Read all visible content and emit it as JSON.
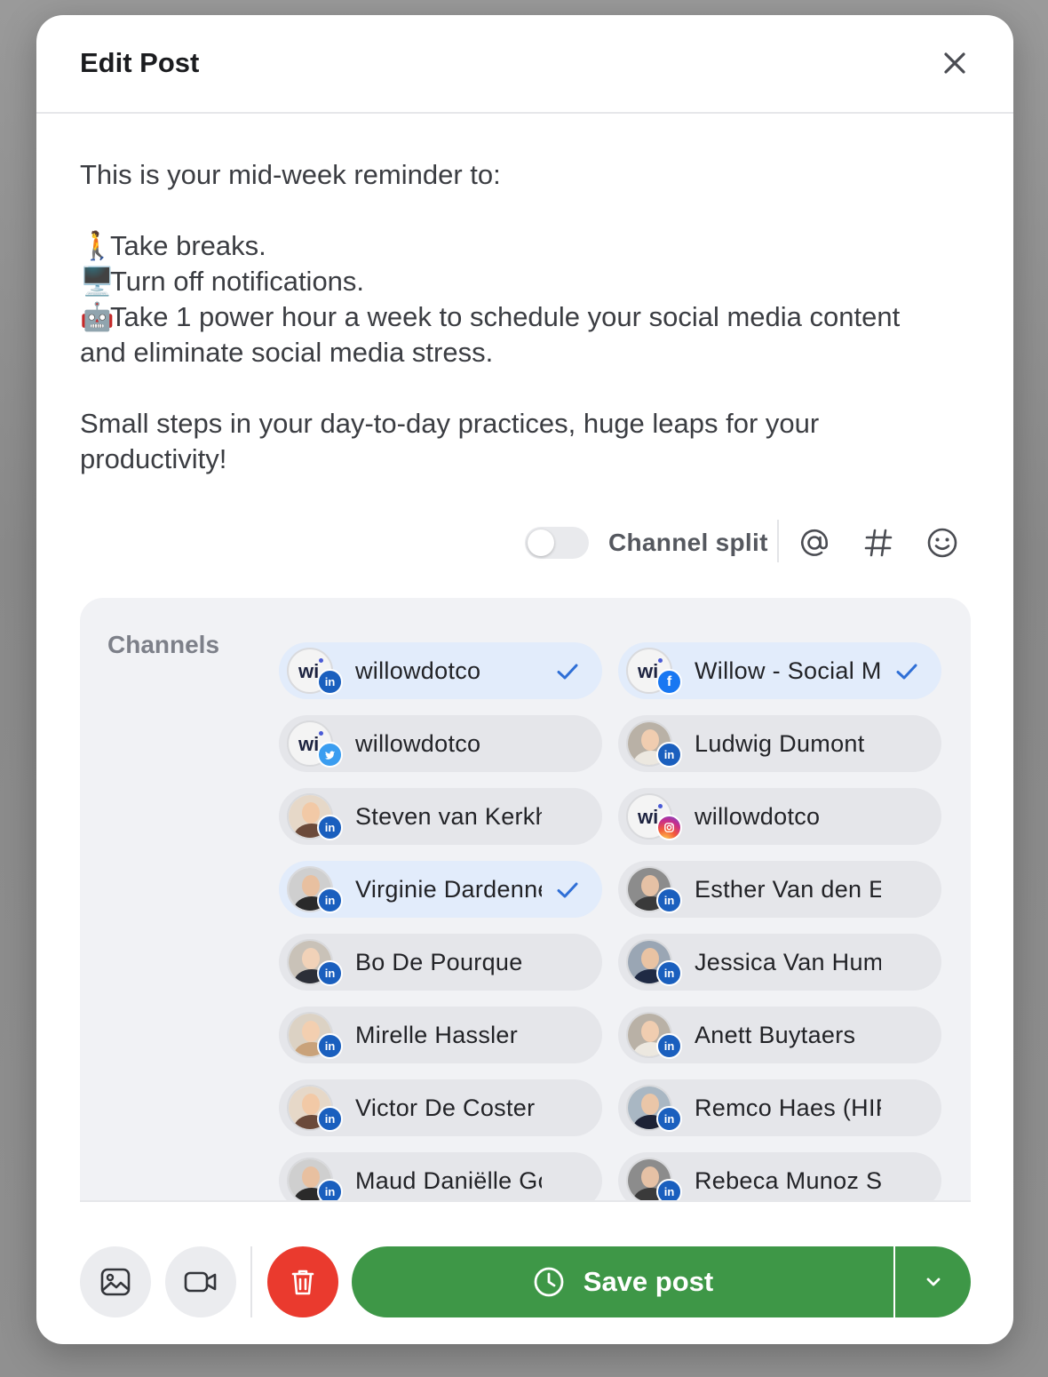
{
  "modal": {
    "title": "Edit Post"
  },
  "post": {
    "lines": [
      {
        "emoji": "",
        "text": "This is your mid-week reminder to:"
      },
      {
        "emoji": "",
        "text": ""
      },
      {
        "emoji": "🚶",
        "text": "Take breaks."
      },
      {
        "emoji": "🖥️",
        "text": "Turn off notifications."
      },
      {
        "emoji": "🤖",
        "text": "Take 1 power hour a week to schedule your social media content"
      },
      {
        "emoji": "",
        "text": "and eliminate social media stress."
      },
      {
        "emoji": "",
        "text": ""
      },
      {
        "emoji": "",
        "text": "Small steps in your day-to-day practices, huge leaps for your"
      },
      {
        "emoji": "",
        "text": "productivity!"
      }
    ]
  },
  "toolbar": {
    "channel_split_label": "Channel split",
    "channel_split_on": false,
    "icons": [
      "mention-icon",
      "hashtag-icon",
      "emoji-icon"
    ]
  },
  "channels": {
    "label": "Channels",
    "items": [
      {
        "name": "willowdotco",
        "network": "linkedin",
        "selected": true,
        "avatar": "brand"
      },
      {
        "name": "Willow - Social Media",
        "network": "facebook",
        "selected": true,
        "avatar": "brand"
      },
      {
        "name": "willowdotco",
        "network": "twitter",
        "selected": false,
        "avatar": "brand"
      },
      {
        "name": "Ludwig Dumont",
        "network": "linkedin",
        "selected": false,
        "avatar": "person"
      },
      {
        "name": "Steven van Kerkhove",
        "network": "linkedin",
        "selected": false,
        "avatar": "person"
      },
      {
        "name": "willowdotco",
        "network": "instagram",
        "selected": false,
        "avatar": "brand"
      },
      {
        "name": "Virginie Dardenne",
        "network": "linkedin",
        "selected": true,
        "avatar": "person"
      },
      {
        "name": "Esther Van den Eynde",
        "network": "linkedin",
        "selected": false,
        "avatar": "person"
      },
      {
        "name": "Bo De Pourque",
        "network": "linkedin",
        "selected": false,
        "avatar": "person"
      },
      {
        "name": "Jessica Van Hummelen",
        "network": "linkedin",
        "selected": false,
        "avatar": "person"
      },
      {
        "name": "Mirelle Hassler",
        "network": "linkedin",
        "selected": false,
        "avatar": "person"
      },
      {
        "name": "Anett Buytaers",
        "network": "linkedin",
        "selected": false,
        "avatar": "person"
      },
      {
        "name": "Victor De Coster",
        "network": "linkedin",
        "selected": false,
        "avatar": "person"
      },
      {
        "name": "Remco Haes (HIRING)",
        "network": "linkedin",
        "selected": false,
        "avatar": "person"
      },
      {
        "name": "Maud Daniëlle Goossens",
        "network": "linkedin",
        "selected": false,
        "avatar": "person"
      },
      {
        "name": "Rebeca Munoz S",
        "network": "linkedin",
        "selected": false,
        "avatar": "person"
      }
    ]
  },
  "footer": {
    "save_label": "Save post"
  },
  "colors": {
    "accent_green": "#3e9747",
    "delete_red": "#ea3a2e",
    "selected_bg": "#e2ecfb",
    "check_blue": "#2f6fd6",
    "linkedin": "#1a5fbe",
    "facebook": "#1877f2",
    "twitter": "#3a9df0"
  }
}
